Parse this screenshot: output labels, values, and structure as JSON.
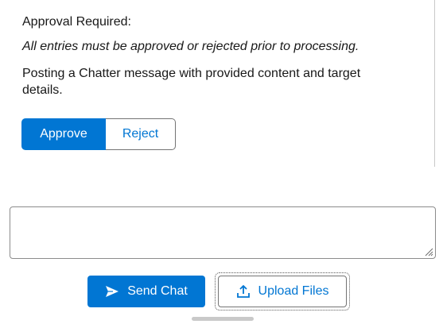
{
  "approval": {
    "title": "Approval Required:",
    "notice": "All entries must be approved or rejected prior to processing.",
    "description": "Posting a Chatter message with provided content and target details.",
    "approve_label": "Approve",
    "reject_label": "Reject"
  },
  "composer": {
    "input_value": "",
    "send_label": "Send Chat",
    "upload_label": "Upload Files"
  },
  "icons": {
    "send": "send-icon",
    "upload": "upload-icon",
    "resize": "resize-grip-icon"
  },
  "colors": {
    "brand_blue": "#0176d3",
    "border_gray": "#747474",
    "text": "#181818"
  }
}
